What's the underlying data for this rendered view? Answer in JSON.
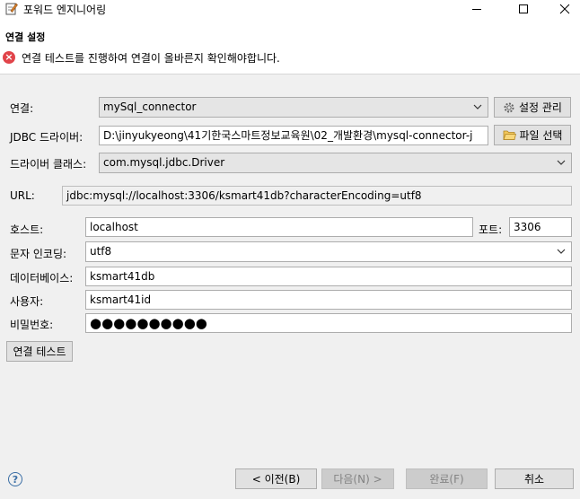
{
  "window": {
    "title": "포워드 엔지니어링",
    "minimize_icon": "minimize-icon",
    "maximize_icon": "maximize-icon",
    "close_icon": "close-icon"
  },
  "header": {
    "section_title": "연결 설정",
    "error_message": "연결 테스트를 진행하여 연결이 올바른지 확인해야합니다.",
    "error_icon": "error-icon"
  },
  "form": {
    "connection": {
      "label": "연결:",
      "value": "mySql_connector",
      "manage_button": "설정 관리"
    },
    "jdbc_driver": {
      "label": "JDBC 드라이버:",
      "value": "D:\\jinyukyeong\\41기한국스마트정보교육원\\02_개발환경\\mysql-connector-j",
      "file_button": "파일 선택"
    },
    "driver_class": {
      "label": "드라이버 클래스:",
      "value": "com.mysql.jdbc.Driver"
    },
    "url": {
      "label": "URL:",
      "value": "jdbc:mysql://localhost:3306/ksmart41db?characterEncoding=utf8"
    },
    "host": {
      "label": "호스트:",
      "value": "localhost"
    },
    "port": {
      "label": "포트:",
      "value": "3306"
    },
    "encoding": {
      "label": "문자 인코딩:",
      "value": "utf8"
    },
    "database": {
      "label": "데이터베이스:",
      "value": "ksmart41db"
    },
    "user": {
      "label": "사용자:",
      "value": "ksmart41id"
    },
    "password": {
      "label": "비밀번호:",
      "value": "●●●●●●●●●●"
    },
    "test_button": "연결 테스트"
  },
  "footer": {
    "back": "< 이전(B)",
    "next": "다음(N) >",
    "finish": "완료(F)",
    "cancel": "취소"
  }
}
